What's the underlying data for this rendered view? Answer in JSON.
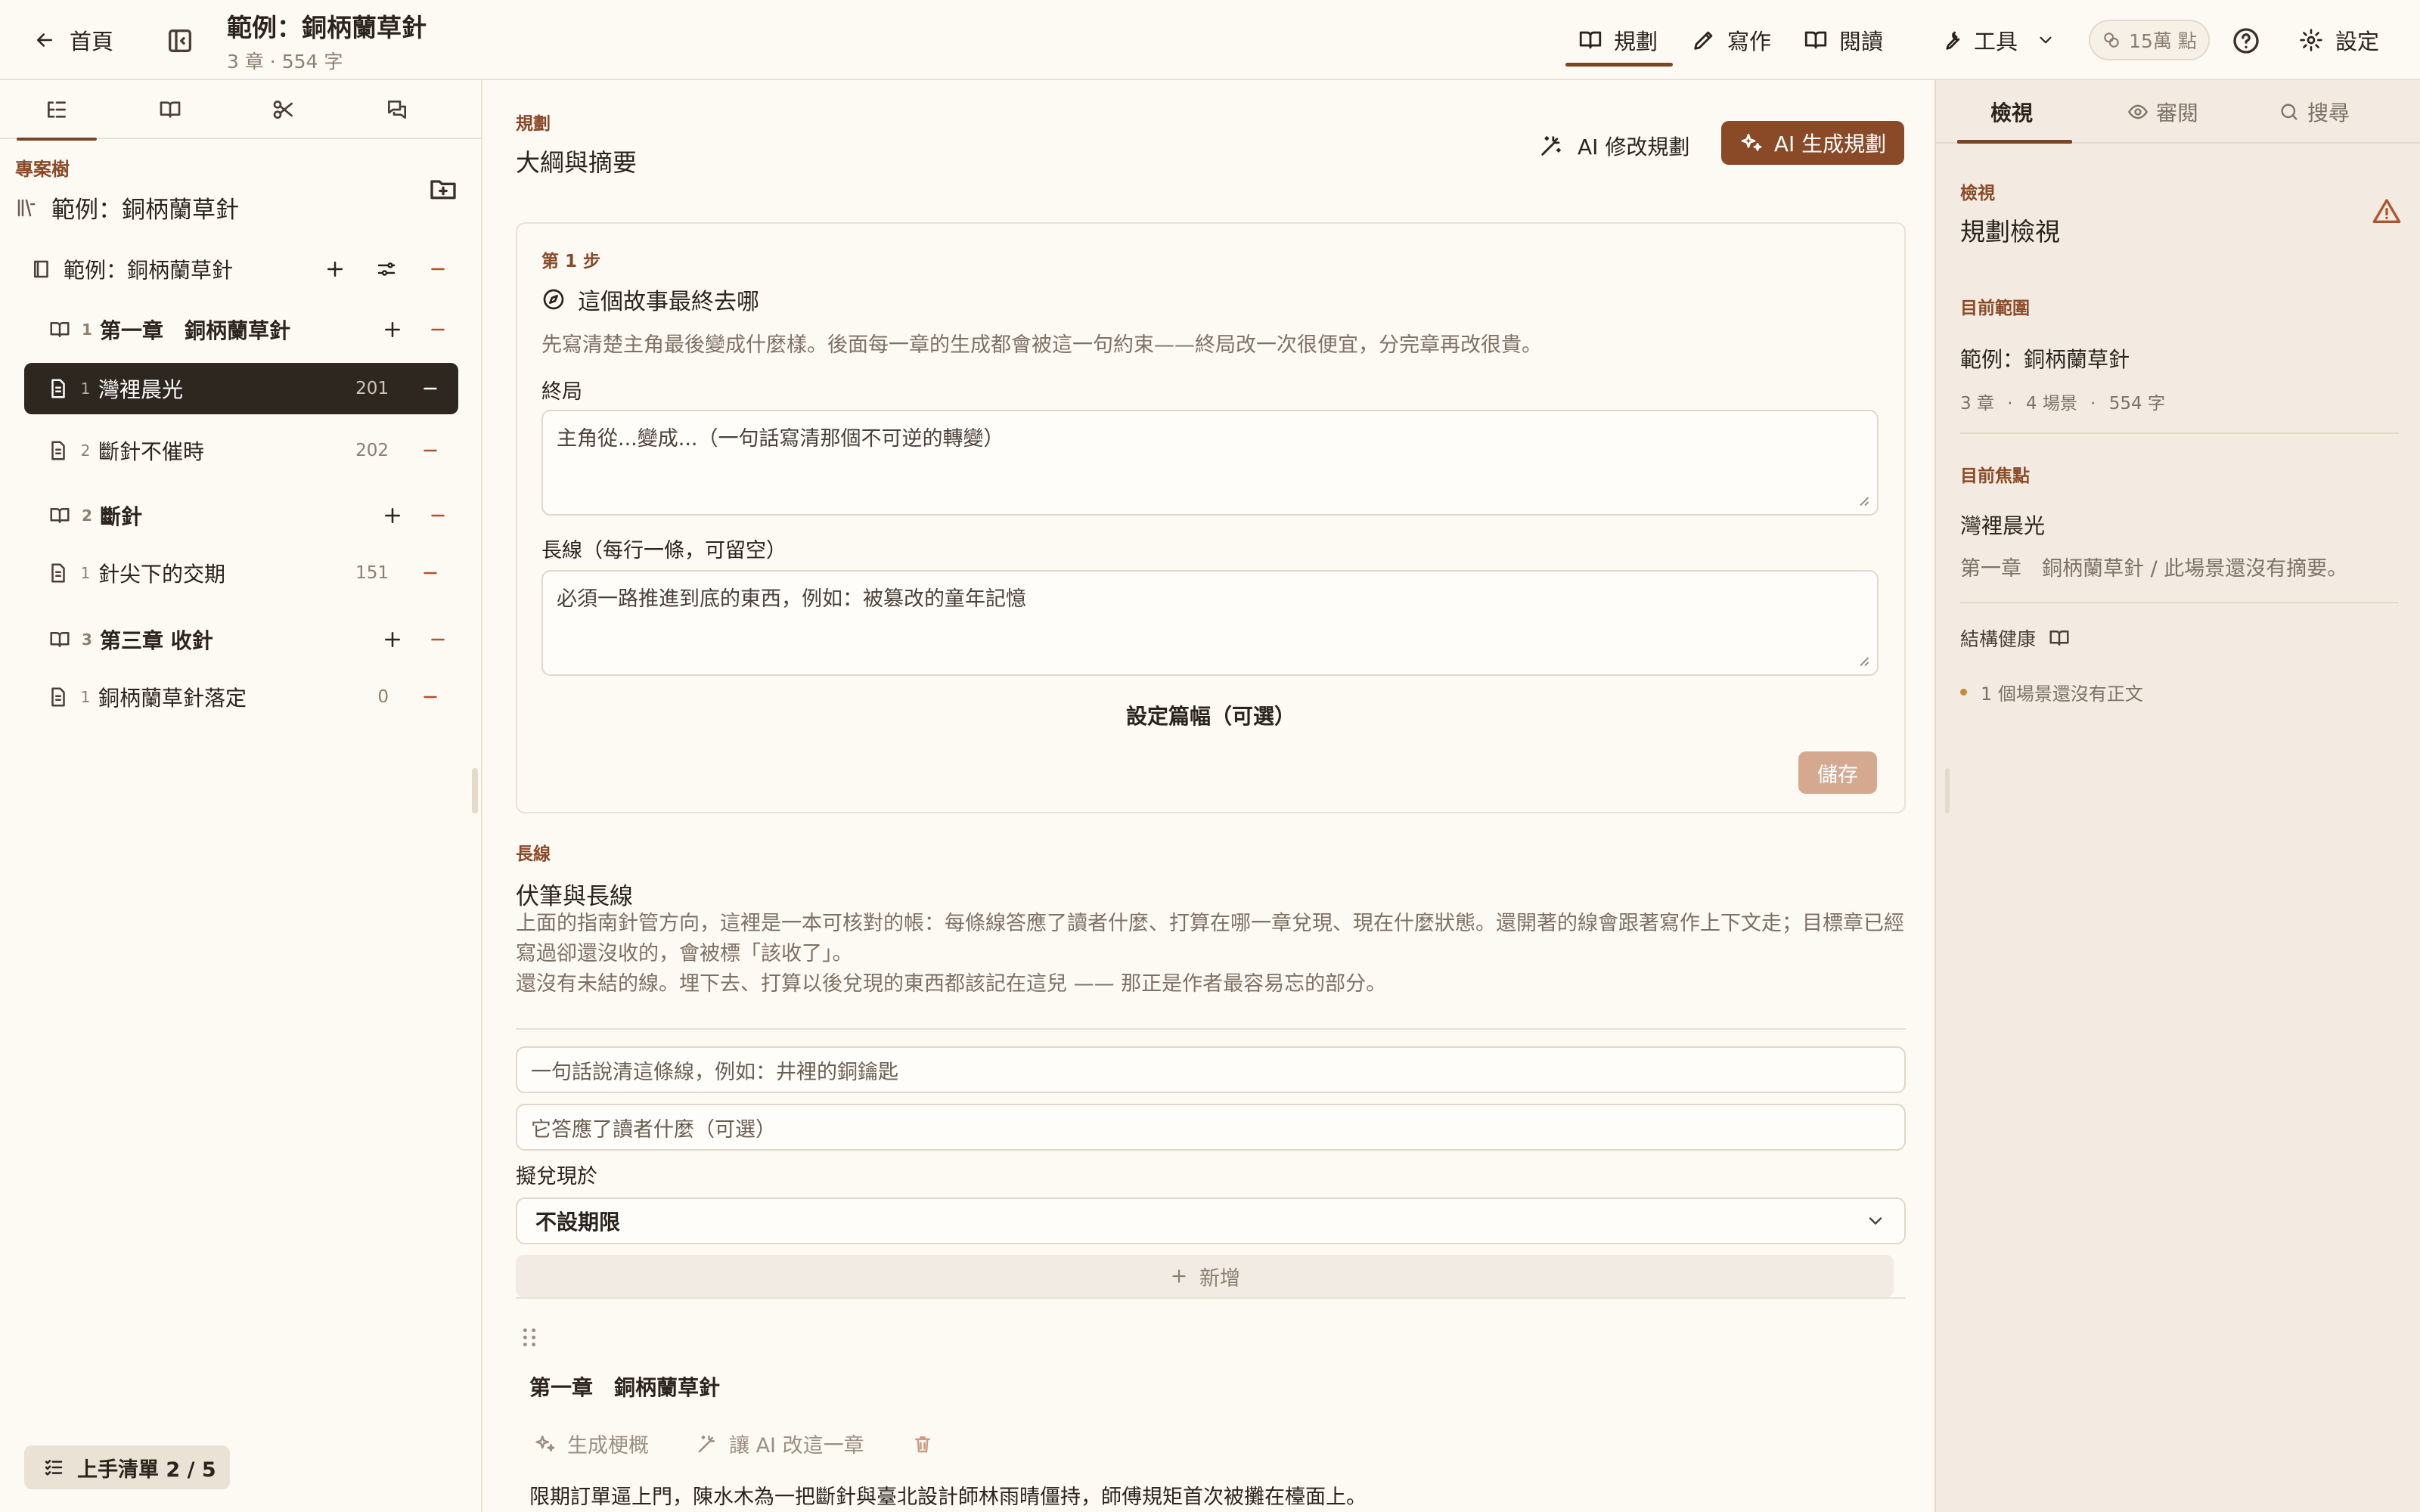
{
  "topbar": {
    "home_label": "首頁",
    "title": "範例：銅柄蘭草針",
    "subtitle": "3 章 · 554 字",
    "nav": {
      "plan": "規劃",
      "write": "寫作",
      "read": "閱讀",
      "tools": "工具"
    },
    "points": "15萬 點",
    "settings": "設定"
  },
  "sidebar": {
    "section_label": "專案樹",
    "project_name": "範例：銅柄蘭草針",
    "tree": {
      "book": {
        "label": "範例：銅柄蘭草針"
      },
      "chapters": [
        {
          "num": "1",
          "label": "第一章　銅柄蘭草針",
          "scenes": [
            {
              "num": "1",
              "label": "灣裡晨光",
              "count": "201"
            },
            {
              "num": "2",
              "label": "斷針不催時",
              "count": "202"
            }
          ]
        },
        {
          "num": "2",
          "label": "斷針",
          "scenes": [
            {
              "num": "1",
              "label": "針尖下的交期",
              "count": "151"
            }
          ]
        },
        {
          "num": "3",
          "label": "第三章 收針",
          "scenes": [
            {
              "num": "1",
              "label": "銅柄蘭草針落定",
              "count": "0"
            }
          ]
        }
      ]
    },
    "checklist": "上手清單 2 / 5"
  },
  "main": {
    "section_label": "規劃",
    "section_title": "大綱與摘要",
    "ai_revise": "AI 修改規劃",
    "ai_generate": "AI 生成規劃",
    "step_card": {
      "step": "第 1 步",
      "question": "這個故事最終去哪",
      "hint": "先寫清楚主角最後變成什麼樣。後面每一章的生成都會被這一句約束——終局改一次很便宜，分完章再改很貴。",
      "ending_label": "終局",
      "ending_placeholder": "主角從...變成...（一句話寫清那個不可逆的轉變）",
      "arcs_label": "長線（每行一條，可留空）",
      "arcs_placeholder": "必須一路推進到底的東西，例如：被篡改的童年記憶",
      "length_link": "設定篇幅（可選）",
      "save": "儲存"
    },
    "threads": {
      "section_label": "長線",
      "title": "伏筆與長線",
      "desc_1": "上面的指南針管方向，這裡是一本可核對的帳：每條線答應了讀者什麼、打算在哪一章兌現、現在什麼狀態。還開著的線會跟著寫作上下文走；目標章已經寫過卻還沒收的，會被標「該收了」。",
      "desc_2": "還沒有未結的線。埋下去、打算以後兌現的東西都該記在這兒 —— 那正是作者最容易忘的部分。",
      "thread_placeholder": "一句話說清這條線，例如：井裡的銅鑰匙",
      "promise_placeholder": "它答應了讀者什麼（可選）",
      "payoff_label": "擬兌現於",
      "payoff_value": "不設期限",
      "add": "新增"
    },
    "chapter": {
      "title": "第一章　銅柄蘭草針",
      "gen_summary": "生成梗概",
      "ai_improve": "讓 AI 改這一章",
      "summary": "限期訂單逼上門，陳水木為一把斷針與臺北設計師林雨晴僵持，師傅規矩首次被攤在檯面上。"
    }
  },
  "right_panel": {
    "tabs": {
      "view": "檢視",
      "review": "審閱",
      "search": "搜尋"
    },
    "section_label": "檢視",
    "title": "規劃檢視",
    "scope_label": "目前範圍",
    "scope_name": "範例：銅柄蘭草針",
    "scope_meta": {
      "chapters": "3 章",
      "scenes": "4 場景",
      "words": "554 字"
    },
    "focus_label": "目前焦點",
    "focus_name": "灣裡晨光",
    "focus_desc": "第一章　銅柄蘭草針 / 此場景還沒有摘要。",
    "health_label": "結構健康",
    "health_item": "1 個場景還沒有正文"
  },
  "colors": {
    "accent": "#8a4a28",
    "background": "#fdf9f3",
    "panel": "#f3ebe1",
    "selected_row": "#2e2720",
    "danger": "#b0542c"
  }
}
